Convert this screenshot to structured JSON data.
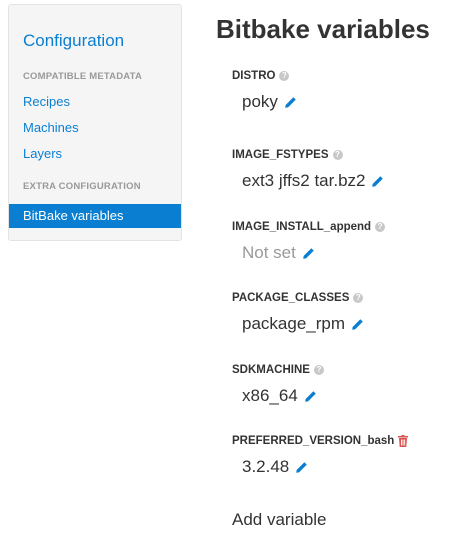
{
  "sidebar": {
    "title": "Configuration",
    "sections": [
      {
        "header": "COMPATIBLE METADATA",
        "items": [
          "Recipes",
          "Machines",
          "Layers"
        ]
      },
      {
        "header": "EXTRA CONFIGURATION",
        "items": [
          "BitBake variables"
        ]
      }
    ],
    "active_item": "BitBake variables"
  },
  "main": {
    "title": "Bitbake variables",
    "variables": [
      {
        "name": "DISTRO",
        "value": "poky",
        "icon": "help-icon"
      },
      {
        "name": "IMAGE_FSTYPES",
        "value": "ext3 jffs2 tar.bz2",
        "icon": "help-icon"
      },
      {
        "name": "IMAGE_INSTALL_append",
        "value": "Not set",
        "icon": "help-icon"
      },
      {
        "name": "PACKAGE_CLASSES",
        "value": "package_rpm",
        "icon": "help-icon"
      },
      {
        "name": "SDKMACHINE",
        "value": "x86_64",
        "icon": "help-icon"
      },
      {
        "name": "PREFERRED_VERSION_bash",
        "value": "3.2.48",
        "icon": "trash-icon"
      }
    ],
    "add_variable_label": "Add variable"
  },
  "colors": {
    "link": "#0a7fd1",
    "active_bg": "#0a7fd1",
    "sidebar_bg": "#f5f5f5",
    "help_icon": "#c8c8c8",
    "trash_icon": "#d9534f",
    "muted_text": "#999999"
  }
}
